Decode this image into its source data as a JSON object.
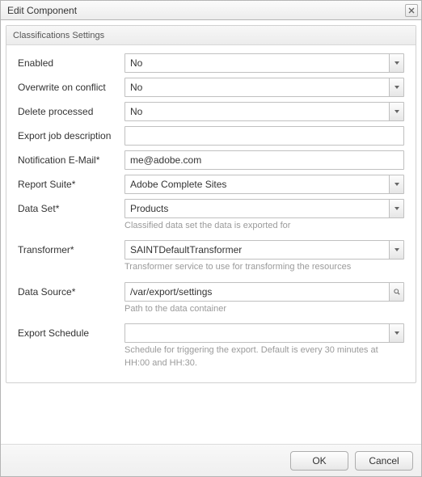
{
  "dialog": {
    "title": "Edit Component"
  },
  "fieldset": {
    "title": "Classifications Settings"
  },
  "fields": {
    "enabled": {
      "label": "Enabled",
      "value": "No"
    },
    "overwrite": {
      "label": "Overwrite on conflict",
      "value": "No"
    },
    "deleteProcessed": {
      "label": "Delete processed",
      "value": "No"
    },
    "exportJobDesc": {
      "label": "Export job description",
      "value": ""
    },
    "notificationEmail": {
      "label": "Notification E-Mail*",
      "value": "me@adobe.com"
    },
    "reportSuite": {
      "label": "Report Suite*",
      "value": "Adobe Complete Sites"
    },
    "dataSet": {
      "label": "Data Set*",
      "value": "Products",
      "hint": "Classified data set the data is exported for"
    },
    "transformer": {
      "label": "Transformer*",
      "value": "SAINTDefaultTransformer",
      "hint": "Transformer service to use for transforming the resources"
    },
    "dataSource": {
      "label": "Data Source*",
      "value": "/var/export/settings",
      "hint": "Path to the data container"
    },
    "exportSchedule": {
      "label": "Export Schedule",
      "value": "",
      "hint": "Schedule for triggering the export. Default is every 30 minutes at HH:00 and HH:30."
    }
  },
  "buttons": {
    "ok": "OK",
    "cancel": "Cancel"
  }
}
